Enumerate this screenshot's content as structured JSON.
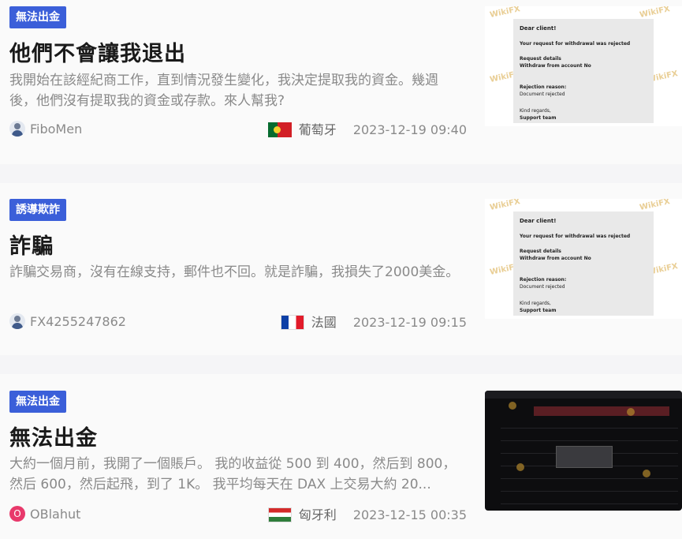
{
  "posts": [
    {
      "tag": "無法出金",
      "title": "他們不會讓我退出",
      "description": "我開始在該經紀商工作，直到情況發生變化，我決定提取我的資金。幾週後，他們沒有提取我的資金或存款。來人幫我?",
      "username": "FiboMen",
      "avatar": "user-avatar-icon",
      "flag": "portugal-flag-icon",
      "country": "葡萄牙",
      "timestamp": "2023-12-19 09:40",
      "thumb": {
        "line1": "Dear client!",
        "line2": "Your request for withdrawal was rejected",
        "line3": "Request details",
        "line4": "Withdraw from account No",
        "line5": "Rejection reason:",
        "line6": "Document rejected",
        "line7": "Kind regards,",
        "line8": "Support team",
        "watermark": "WikiFX"
      }
    },
    {
      "tag": "誘導欺詐",
      "title": "詐騙",
      "description": "詐騙交易商，沒有在線支持，郵件也不回。就是詐騙，我損失了2000美金。",
      "username": "FX4255247862",
      "avatar": "user-avatar-icon",
      "flag": "france-flag-icon",
      "country": "法國",
      "timestamp": "2023-12-19 09:15",
      "thumb": {
        "line1": "Dear client!",
        "line2": "Your request for withdrawal was rejected",
        "line3": "Request details",
        "line4": "Withdraw from account No",
        "line5": "Rejection reason:",
        "line6": "Document rejected",
        "line7": "Kind regards,",
        "line8": "Support team",
        "watermark": "WikiFX"
      }
    },
    {
      "tag": "無法出金",
      "title": "無法出金",
      "description": "大約一個月前，我開了一個賬戶。 我的收益從 500 到 400，然后到 800，然后 600，然后起飛，到了 1K。 我平均每天在 DAX 上交易大約 20...",
      "username": "OBlahut",
      "avatar_letter": "O",
      "flag": "hungary-flag-icon",
      "country": "匈牙利",
      "timestamp": "2023-12-15 00:35"
    }
  ],
  "colors": {
    "tag_bg": "#3b5fd9",
    "title": "#1a1a1a",
    "muted": "#8a8a8a"
  }
}
